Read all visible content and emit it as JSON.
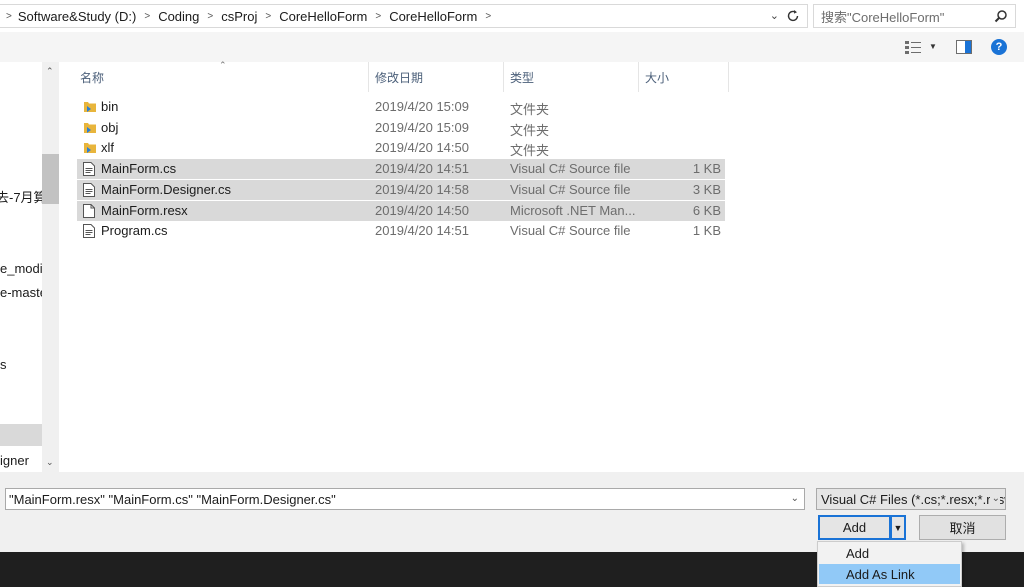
{
  "address_bar": {
    "crumbs": [
      "Software&Study (D:)",
      "Coding",
      "csProj",
      "CoreHelloForm",
      "CoreHelloForm"
    ],
    "search_placeholder": "搜索\"CoreHelloForm\""
  },
  "icons": {
    "refresh": "refresh-icon",
    "search": "search-icon",
    "view": "view-options-icon",
    "preview_pane": "preview-pane-icon",
    "help": "help-icon",
    "help_glyph": "?"
  },
  "nav_pane": {
    "items": [
      "去-7月算",
      "e_modi",
      "e-maste",
      "s",
      "igner"
    ]
  },
  "file_list": {
    "columns": {
      "name": "名称",
      "date": "修改日期",
      "type": "类型",
      "size": "大小"
    },
    "rows": [
      {
        "name": "bin",
        "date": "2019/4/20 15:09",
        "type": "文件夹",
        "size": "",
        "icon": "folder-icon",
        "selected": false
      },
      {
        "name": "obj",
        "date": "2019/4/20 15:09",
        "type": "文件夹",
        "size": "",
        "icon": "folder-icon",
        "selected": false
      },
      {
        "name": "xlf",
        "date": "2019/4/20 14:50",
        "type": "文件夹",
        "size": "",
        "icon": "folder-icon",
        "selected": false
      },
      {
        "name": "MainForm.cs",
        "date": "2019/4/20 14:51",
        "type": "Visual C# Source file",
        "size": "1 KB",
        "icon": "cs-file-icon",
        "selected": true
      },
      {
        "name": "MainForm.Designer.cs",
        "date": "2019/4/20 14:58",
        "type": "Visual C# Source file",
        "size": "3 KB",
        "icon": "cs-file-icon",
        "selected": true
      },
      {
        "name": "MainForm.resx",
        "date": "2019/4/20 14:50",
        "type": "Microsoft .NET Man...",
        "size": "6 KB",
        "icon": "resx-file-icon",
        "selected": true
      },
      {
        "name": "Program.cs",
        "date": "2019/4/20 14:51",
        "type": "Visual C# Source file",
        "size": "1 KB",
        "icon": "cs-file-icon",
        "selected": false
      }
    ]
  },
  "bottom": {
    "filename_value": "\"MainForm.resx\" \"MainForm.cs\" \"MainForm.Designer.cs\"",
    "filetype_value": "Visual C# Files (*.cs;*.resx;*.resw",
    "add_label": "Add",
    "cancel_label": "取消"
  },
  "add_menu": {
    "items": [
      {
        "label": "Add",
        "highlighted": false
      },
      {
        "label": "Add As Link",
        "highlighted": true
      }
    ]
  },
  "colors": {
    "accent": "#1a73d6",
    "selection": "#d9d9d9",
    "menu_highlight": "#91c9f7",
    "folder": "#e8b53c"
  }
}
